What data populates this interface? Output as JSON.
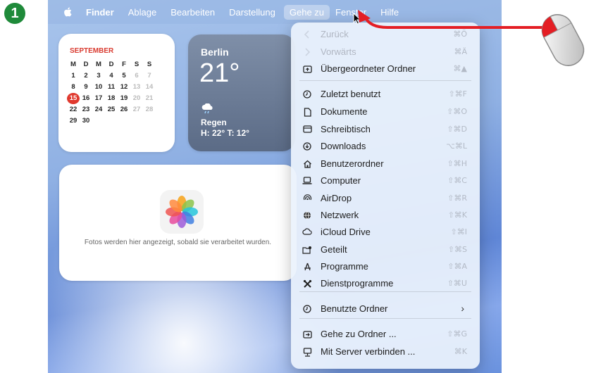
{
  "step": {
    "number": "1",
    "color": "#1f8a3a"
  },
  "menubar": {
    "app": "Finder",
    "items": [
      "Ablage",
      "Bearbeiten",
      "Darstellung",
      "Gehe zu",
      "Fenster",
      "Hilfe"
    ],
    "active_item": "Gehe zu"
  },
  "calendar": {
    "month": "SEPTEMBER",
    "weekdays": [
      "M",
      "D",
      "M",
      "D",
      "F",
      "S",
      "S"
    ],
    "weeks": [
      [
        "1",
        "2",
        "3",
        "4",
        "5",
        "6",
        "7"
      ],
      [
        "8",
        "9",
        "10",
        "11",
        "12",
        "13",
        "14"
      ],
      [
        "15",
        "16",
        "17",
        "18",
        "19",
        "20",
        "21"
      ],
      [
        "22",
        "23",
        "24",
        "25",
        "26",
        "27",
        "28"
      ],
      [
        "29",
        "30",
        "",
        "",
        "",
        "",
        ""
      ]
    ],
    "today": "15"
  },
  "weather": {
    "city": "Berlin",
    "temp": "21°",
    "condition": "Regen",
    "high_low": "H: 22° T: 12°"
  },
  "photos": {
    "message": "Fotos werden hier angezeigt, sobald sie verarbeitet wurden."
  },
  "menu": {
    "items": [
      {
        "label": "Zurück",
        "shortcut": "⌘Ö",
        "icon": "chevron-left-icon",
        "disabled": true
      },
      {
        "label": "Vorwärts",
        "shortcut": "⌘Ä",
        "icon": "chevron-right-icon",
        "disabled": true
      },
      {
        "label": "Übergeordneter Ordner",
        "shortcut": "⌘▲",
        "icon": "parent-folder-icon",
        "disabled": false
      },
      {
        "label": "Zuletzt benutzt",
        "shortcut": "⇧⌘F",
        "icon": "clock-icon",
        "disabled": false
      },
      {
        "label": "Dokumente",
        "shortcut": "⇧⌘O",
        "icon": "document-icon",
        "disabled": false
      },
      {
        "label": "Schreibtisch",
        "shortcut": "⇧⌘D",
        "icon": "desktop-icon",
        "disabled": false
      },
      {
        "label": "Downloads",
        "shortcut": "⌥⌘L",
        "icon": "download-icon",
        "disabled": false
      },
      {
        "label": "Benutzerordner",
        "shortcut": "⇧⌘H",
        "icon": "home-icon",
        "disabled": false
      },
      {
        "label": "Computer",
        "shortcut": "⇧⌘C",
        "icon": "laptop-icon",
        "disabled": false
      },
      {
        "label": "AirDrop",
        "shortcut": "⇧⌘R",
        "icon": "airdrop-icon",
        "disabled": false
      },
      {
        "label": "Netzwerk",
        "shortcut": "⇧⌘K",
        "icon": "network-globe-icon",
        "disabled": false
      },
      {
        "label": "iCloud Drive",
        "shortcut": "⇧⌘I",
        "icon": "cloud-icon",
        "disabled": false
      },
      {
        "label": "Geteilt",
        "shortcut": "⇧⌘S",
        "icon": "shared-folder-icon",
        "disabled": false
      },
      {
        "label": "Programme",
        "shortcut": "⇧⌘A",
        "icon": "applications-icon",
        "disabled": false
      },
      {
        "label": "Dienstprogramme",
        "shortcut": "⇧⌘U",
        "icon": "utilities-icon",
        "disabled": false
      },
      {
        "label": "Benutzte Ordner",
        "shortcut": "",
        "icon": "clock-icon",
        "disabled": false,
        "submenu": true
      },
      {
        "label": "Gehe zu Ordner ...",
        "shortcut": "⇧⌘G",
        "icon": "goto-folder-icon",
        "disabled": false
      },
      {
        "label": "Mit Server verbinden ...",
        "shortcut": "⌘K",
        "icon": "server-icon",
        "disabled": false
      }
    ]
  },
  "annotation_color": "#e41e24"
}
